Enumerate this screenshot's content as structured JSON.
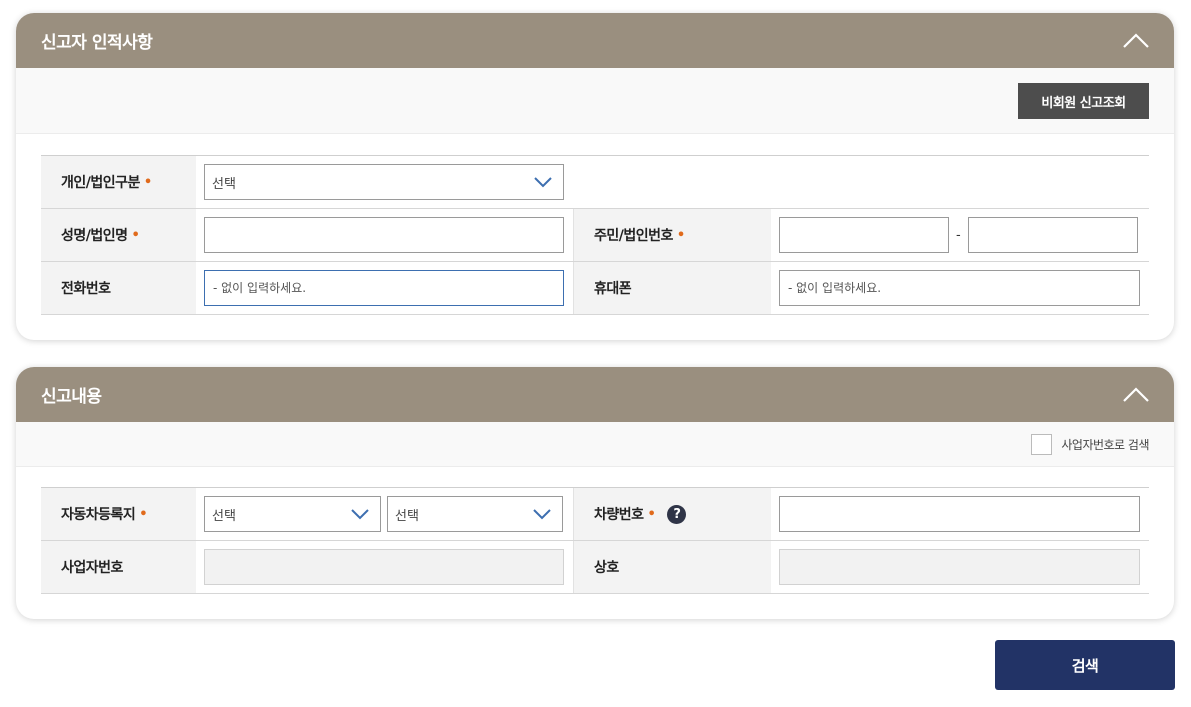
{
  "reporter_section": {
    "title": "신고자 인적사항",
    "nonmember_button": "비회원 신고조회",
    "fields": {
      "type_label": "개인/법인구분",
      "type_value": "선택",
      "name_label": "성명/법인명",
      "name_value": "",
      "id_label": "주민/법인번호",
      "id_part1": "",
      "id_separator": "-",
      "id_part2": "",
      "phone_label": "전화번호",
      "phone_placeholder": "- 없이 입력하세요.",
      "mobile_label": "휴대폰",
      "mobile_placeholder": "- 없이 입력하세요."
    }
  },
  "report_section": {
    "title": "신고내용",
    "biz_search_checkbox": "사업자번호로 검색",
    "fields": {
      "region_label": "자동차등록지",
      "region_select1": "선택",
      "region_select2": "선택",
      "plate_label": "차량번호",
      "plate_value": "",
      "biz_no_label": "사업자번호",
      "company_label": "상호"
    }
  },
  "required_mark": "•",
  "help_icon_glyph": "?",
  "search_button": "검색",
  "colors": {
    "header_bg": "#9a8f7f",
    "required_dot": "#e06a1b",
    "primary_button": "#223366",
    "dark_button": "#4d4d4d"
  }
}
